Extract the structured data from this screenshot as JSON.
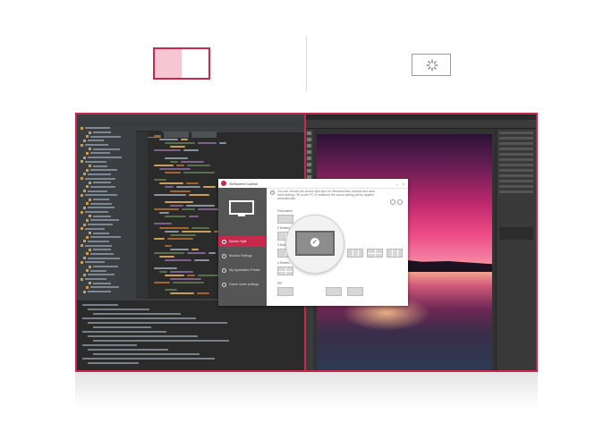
{
  "modes": {
    "selected_mode_icon": "split-screen-icon",
    "alternate_mode_icon": "screen-settings-icon",
    "accent_color": "#c8284b"
  },
  "monitor": {
    "border_color": "#c8284b",
    "left_app": "code-editor",
    "right_app": "photo-editor"
  },
  "dialog": {
    "title": "OnScreen Control",
    "controls": [
      "–",
      "×"
    ],
    "info_text": "You can choose the screen split type for Windows/Mac window and save them setting. Off on the PC or restarted the saved setting will be applied automatically.",
    "sidebar_items": [
      {
        "label": "Screen Split",
        "active": true
      },
      {
        "label": "Monitor Settings",
        "active": false
      },
      {
        "label": "My Application Preset",
        "active": false
      },
      {
        "label": "Game mode settings",
        "active": false
      }
    ],
    "sections": [
      "Full screen",
      "2 Screen",
      "3 Screen",
      "4 Screen",
      "PIP"
    ],
    "selected_layout": "2-screen-split"
  }
}
